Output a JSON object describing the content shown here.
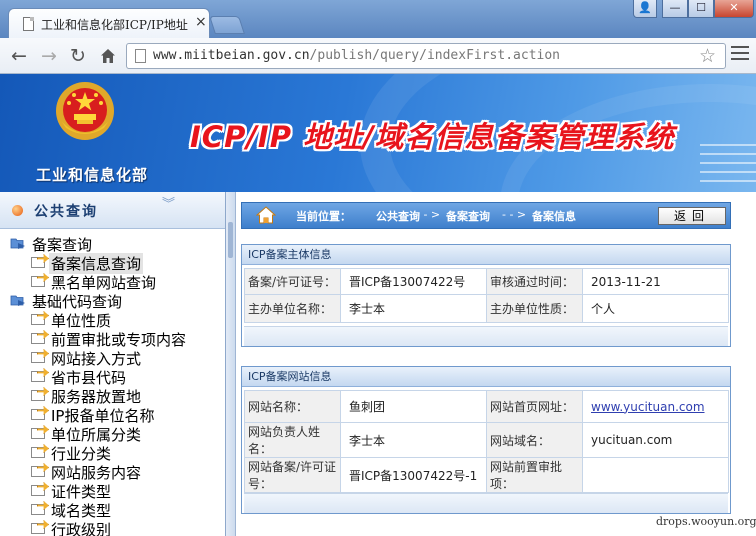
{
  "browser": {
    "tab_title": "工业和信息化部ICP/IP地址",
    "tab_close": "×",
    "url_host": "www.miitbeian.gov.cn",
    "url_path": "/publish/query/indexFirst.action",
    "icons": [
      "back-arrow-icon",
      "forward-arrow-icon",
      "reload-icon",
      "home-icon",
      "bookmark-star-icon",
      "menu-icon"
    ]
  },
  "window_controls": {
    "user": "👤",
    "minimize": "—",
    "maximize": "☐",
    "close": "✕"
  },
  "banner": {
    "ministry": "工业和信息化部",
    "system_title": "ICP/IP 地址/域名信息备案管理系统"
  },
  "sidebar": {
    "title": "公共查询",
    "collapse": "︾",
    "tree": [
      {
        "type": "group",
        "label": "备案查询"
      },
      {
        "type": "leaf",
        "label": "备案信息查询",
        "selected": true
      },
      {
        "type": "leaf",
        "label": "黑名单网站查询"
      },
      {
        "type": "group",
        "label": "基础代码查询"
      },
      {
        "type": "leaf",
        "label": "单位性质"
      },
      {
        "type": "leaf",
        "label": "前置审批或专项内容"
      },
      {
        "type": "leaf",
        "label": "网站接入方式"
      },
      {
        "type": "leaf",
        "label": "省市县代码"
      },
      {
        "type": "leaf",
        "label": "服务器放置地"
      },
      {
        "type": "leaf",
        "label": "IP报备单位名称"
      },
      {
        "type": "leaf",
        "label": "单位所属分类"
      },
      {
        "type": "leaf",
        "label": "行业分类"
      },
      {
        "type": "leaf",
        "label": "网站服务内容"
      },
      {
        "type": "leaf",
        "label": "证件类型"
      },
      {
        "type": "leaf",
        "label": "域名类型"
      },
      {
        "type": "leaf",
        "label": "行政级别"
      }
    ]
  },
  "breadcrumb": {
    "label": "当前位置：",
    "items": [
      "公共查询",
      "备案查询",
      "备案信息"
    ],
    "separator": "- - >",
    "back_button": "返回"
  },
  "subject_panel": {
    "title": "ICP备案主体信息",
    "rows": [
      {
        "label1": "备案/许可证号：",
        "value1": "晋ICP备13007422号",
        "label2": "审核通过时间：",
        "value2": "2013-11-21"
      },
      {
        "label1": "主办单位名称：",
        "value1": "李士本",
        "label2": "主办单位性质：",
        "value2": "个人"
      }
    ]
  },
  "website_panel": {
    "title": "ICP备案网站信息",
    "rows": [
      {
        "label1": "网站名称：",
        "value1": "鱼刺团",
        "label2": "网站首页网址：",
        "value2": "www.yucituan.com",
        "link": true
      },
      {
        "label1": "网站负责人姓名：",
        "value1": "李士本",
        "label2": "网站域名：",
        "value2": "yucituan.com"
      },
      {
        "label1": "网站备案/许可证号：",
        "value1": "晋ICP备13007422号-1",
        "label2": "网站前置审批项：",
        "value2": ""
      }
    ]
  },
  "watermark": "drops.wooyun.org",
  "colors": {
    "banner_blue": "#2a78d6",
    "title_red": "#e8141c",
    "breadcrumb_blue": "#3e7fcc",
    "link_blue": "#2f3fb0"
  }
}
